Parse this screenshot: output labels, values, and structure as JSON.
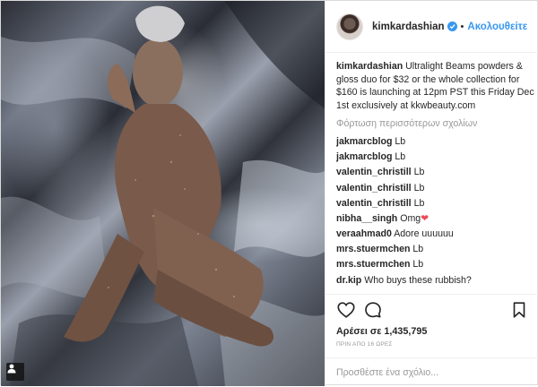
{
  "post": {
    "username": "kimkardashian",
    "header_separator": "•",
    "follow_label": "Ακολουθείτε",
    "caption_user": "kimkardashian",
    "caption_text": "Ultralight Beams powders & gloss duo for $32 or the whole collection for $160 is launching at 12pm PST this Friday Dec 1st exclusively at kkwbeauty.com",
    "load_more_label": "Φόρτωση περισσότερων σχολίων"
  },
  "comments": [
    {
      "user": "jakmarcblog",
      "text": "Lb"
    },
    {
      "user": "jakmarcblog",
      "text": "Lb"
    },
    {
      "user": "valentin_christill",
      "text": "Lb"
    },
    {
      "user": "valentin_christill",
      "text": "Lb"
    },
    {
      "user": "valentin_christill",
      "text": "Lb"
    },
    {
      "user": "nibha__singh",
      "text": "Omg❤"
    },
    {
      "user": "veraahmad0",
      "text": "Adore uuuuuu"
    },
    {
      "user": "mrs.stuermchen",
      "text": "Lb"
    },
    {
      "user": "mrs.stuermchen",
      "text": "Lb"
    },
    {
      "user": "dr.kip",
      "text": "Who buys these rubbish?"
    }
  ],
  "engagement": {
    "likes_label": "Αρέσει σε 1,435,795",
    "time_ago": "ΠΡΙΝ ΑΠΟ 16 ΩΡΕΣ"
  },
  "composer": {
    "placeholder": "Προσθέστε ένα σχόλιο..."
  },
  "icons": {
    "like": "heart-icon",
    "comment": "comment-bubble-icon",
    "save": "bookmark-icon",
    "verified": "verified-badge-icon",
    "photo_tag": "user-tag-icon"
  },
  "colors": {
    "link_blue": "#3897f0",
    "muted_gray": "#999999",
    "text": "#262626",
    "heart_red": "#ed4956"
  }
}
